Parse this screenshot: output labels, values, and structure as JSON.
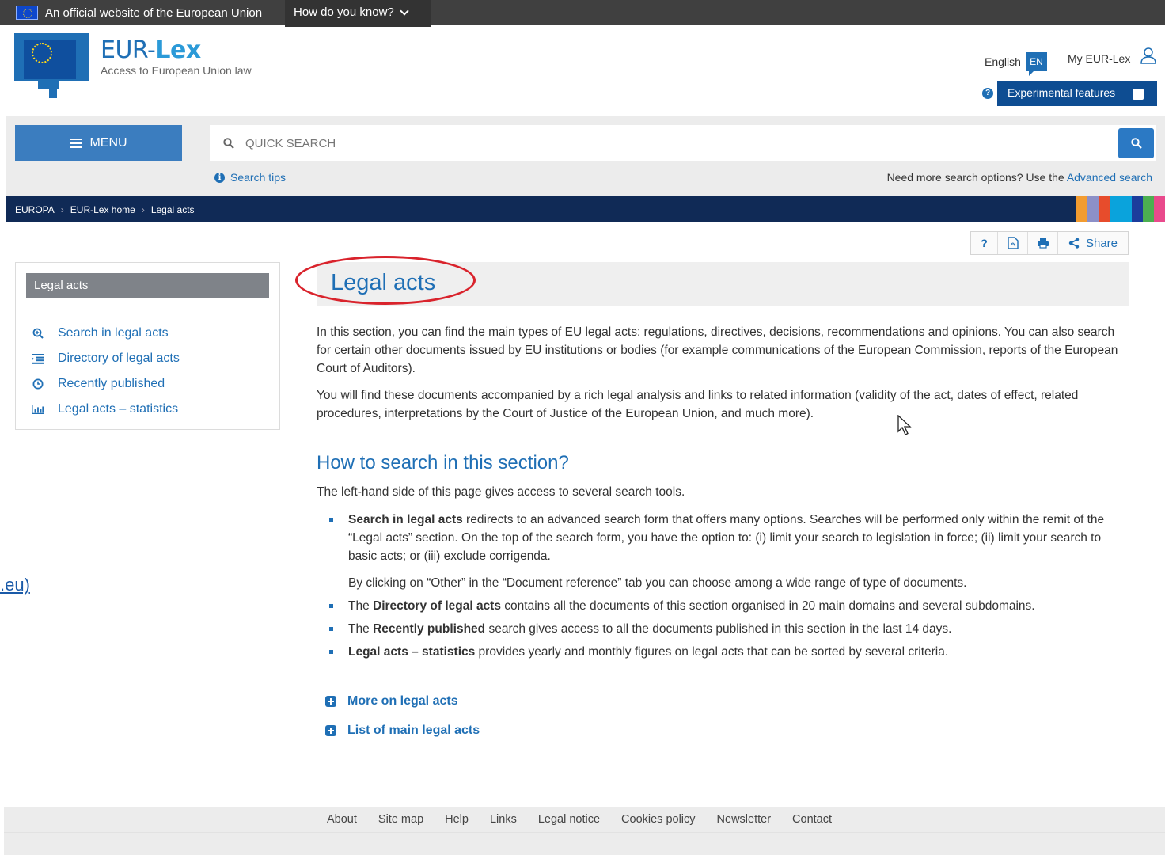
{
  "eu_bar": {
    "official": "An official website of the European Union",
    "how_know": "How do you know?"
  },
  "brand": {
    "title_a": "EUR-",
    "title_b": "Lex",
    "subtitle": "Access to European Union law"
  },
  "header": {
    "language": "English",
    "language_code": "EN",
    "my_eurlex": "My EUR-Lex",
    "experimental": "Experimental features",
    "help": "?"
  },
  "search": {
    "menu_label": "MENU",
    "placeholder": "QUICK SEARCH",
    "tips": "Search tips",
    "advanced_prefix": "Need more search options? Use the",
    "advanced_link": "Advanced search"
  },
  "breadcrumb": [
    "EUROPA",
    "EUR-Lex home",
    "Legal acts"
  ],
  "stripe_colors": [
    "#f39c30",
    "#8c90c8",
    "#e74c2c",
    "#0aa3dc",
    "#0aa3dc",
    "#1c3c9c",
    "#4caf50",
    "#e94a8c"
  ],
  "tools": {
    "help": "?",
    "share": "Share"
  },
  "sidebar": {
    "heading": "Legal acts",
    "items": [
      {
        "label": "Search in legal acts",
        "icon": "search-plus-icon"
      },
      {
        "label": "Directory of legal acts",
        "icon": "list-icon"
      },
      {
        "label": "Recently published",
        "icon": "clock-icon"
      },
      {
        "label": "Legal acts – statistics",
        "icon": "bar-chart-icon"
      }
    ]
  },
  "stray_link": ".eu)",
  "main": {
    "title": "Legal acts",
    "intro_1": "In this section, you can find the main types of EU legal acts: regulations, directives, decisions, recommendations and opinions. You can also search for certain other documents issued by EU institutions or bodies (for example communications of the European Commission, reports of the European Court of Auditors).",
    "intro_2": "You will find these documents accompanied by a rich legal analysis and links to related information (validity of the act, dates of effect, related procedures, interpretations by the Court of Justice of the European Union, and much more).",
    "how_heading": "How to search in this section?",
    "how_intro": "The left-hand side of this page gives access to several search tools.",
    "bullets": [
      {
        "bold": "Search in legal acts",
        "text": " redirects to an advanced search form that offers many options. Searches will be performed only within the remit of the “Legal acts” section. On the top of the search form, you have the option to: (i) limit your search to legislation in force; (ii) limit your search to basic acts; or (iii) exclude corrigenda.",
        "sub": "By clicking on “Other” in the “Document reference” tab you can choose among a wide range of type of documents."
      },
      {
        "pre": "The ",
        "bold": "Directory of legal acts",
        "text": " contains all the documents of this section organised in 20 main domains and several subdomains."
      },
      {
        "pre": "The ",
        "bold": "Recently published",
        "text": " search gives access to all the documents published in this section in the last 14 days."
      },
      {
        "bold": "Legal acts – statistics",
        "text": " provides yearly and monthly figures on legal acts that can be sorted by several criteria."
      }
    ],
    "more_1": "More on legal acts",
    "more_2": "List of main legal acts"
  },
  "footer": {
    "links": [
      "About",
      "Site map",
      "Help",
      "Links",
      "Legal notice",
      "Cookies policy",
      "Newsletter",
      "Contact"
    ]
  }
}
